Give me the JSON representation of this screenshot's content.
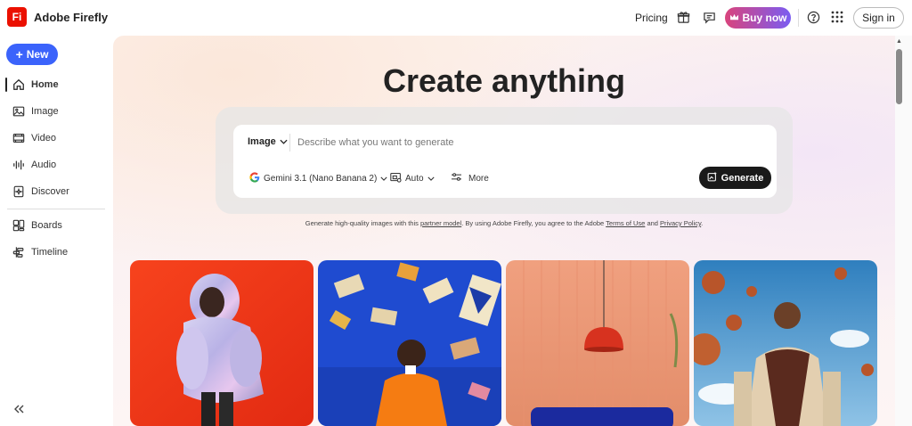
{
  "app": {
    "logo_text": "Fi",
    "title": "Adobe Firefly",
    "brand_color": "#eb1000"
  },
  "topbar": {
    "pricing": "Pricing",
    "gift_icon": "gift-icon",
    "feedback_icon": "chat-feedback-icon",
    "buy_now": "Buy now",
    "help_icon": "help-icon",
    "apps_icon": "apps-grid-icon",
    "sign_in": "Sign in"
  },
  "sidebar": {
    "new_label": "New",
    "items": [
      {
        "label": "Home",
        "icon": "home-icon",
        "active": true
      },
      {
        "label": "Image",
        "icon": "image-icon"
      },
      {
        "label": "Video",
        "icon": "video-icon"
      },
      {
        "label": "Audio",
        "icon": "audio-icon"
      },
      {
        "label": "Discover",
        "icon": "discover-icon"
      },
      {
        "label": "Boards",
        "icon": "boards-icon"
      },
      {
        "label": "Timeline",
        "icon": "timeline-icon"
      }
    ]
  },
  "main": {
    "title": "Create anything",
    "prompt": {
      "mode": "Image",
      "placeholder": "Describe what you want to generate",
      "value": "",
      "model": "Gemini 3.1 (Nano Banana 2)",
      "aspect": "Auto",
      "more": "More",
      "generate": "Generate"
    },
    "disclaimer": {
      "part1": "Generate high-quality images with this ",
      "link1": "partner model",
      "part2": ". By using Adobe Firefly, you agree to the Adobe ",
      "link2": "Terms of Use",
      "part3": " and ",
      "link3": "Privacy Policy",
      "part4": "."
    }
  },
  "colors": {
    "accent": "#3b63fb",
    "generate_bg": "#1a1a1a"
  }
}
